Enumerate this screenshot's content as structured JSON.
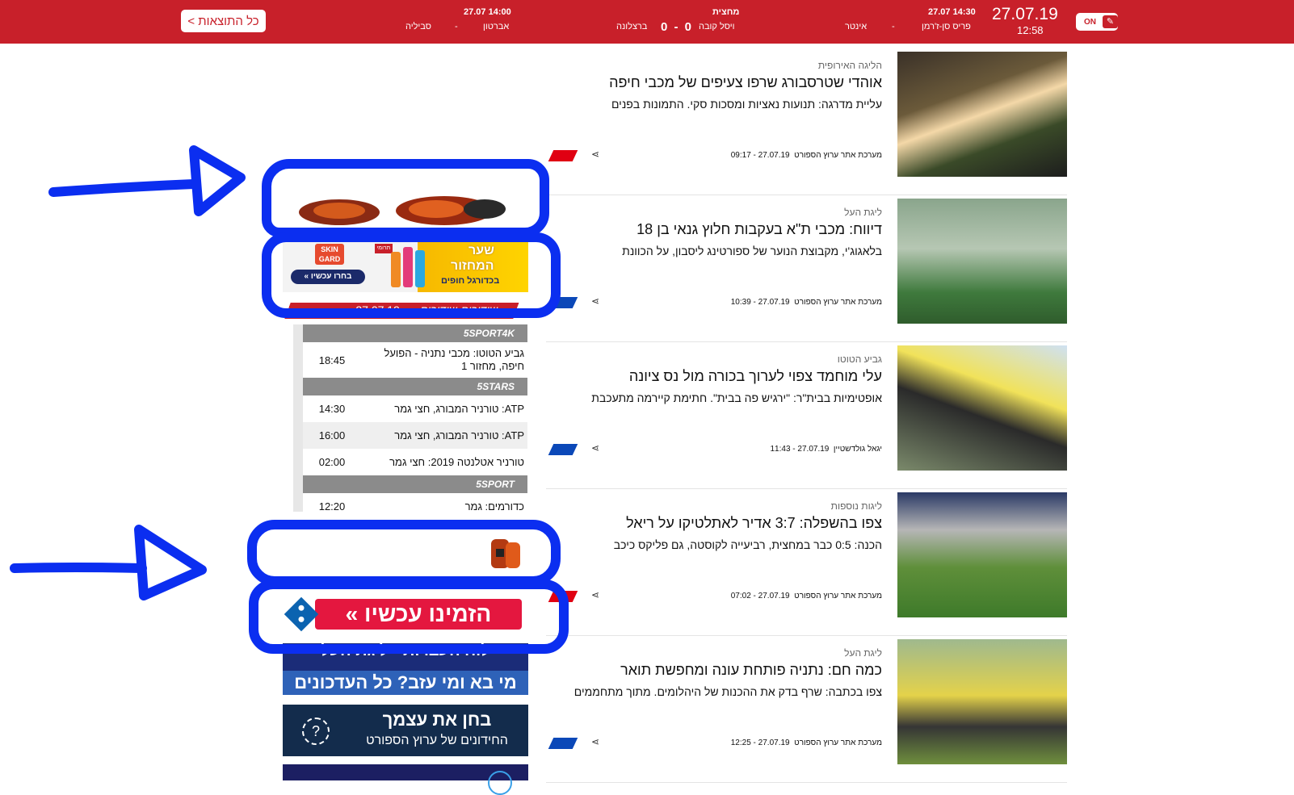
{
  "topbar": {
    "all_results": "כל התוצאות >",
    "date": "27.07.19",
    "time": "12:58",
    "live_toggle": "ON",
    "matches": [
      {
        "time": "27.07 14:30",
        "home": "פריס סן-ז'רמן",
        "score": "-",
        "away": "אינטר"
      },
      {
        "time": "מחצית",
        "home": "ויסל קובה",
        "score": "0 - 0",
        "away": "ברצלונה"
      },
      {
        "time": "27.07 14:00",
        "home": "אברטון",
        "score": "-",
        "away": "סביליה"
      }
    ]
  },
  "articles": [
    {
      "category": "הליגה האירופית",
      "title": "אוהדי שטרסבורג שרפו צעיפים של מכבי חיפה",
      "subtitle": "עליית מדרגה: תנועות נאציות ומסכות סקי. התמונות בפנים",
      "author": "מערכת אתר ערוץ הספורט",
      "datetime": "27.07.19 - 09:17",
      "flag_color": "#e00012"
    },
    {
      "category": "ליגת העל",
      "title": "דיווח: מכבי ת\"א בעקבות חלוץ גנאי בן 18",
      "subtitle": "בלאגוג'י, מקבוצת הנוער של ספורטינג ליסבון, על הכוונת",
      "author": "מערכת אתר ערוץ הספורט",
      "datetime": "27.07.19 - 10:39",
      "flag_color": "#0b48b8"
    },
    {
      "category": "גביע הטוטו",
      "title": "עלי מוחמד צפוי לערוך בכורה מול נס ציונה",
      "subtitle": "אופטימיות בבית\"ר: \"ירגיש פה בבית\". חתימת קיירמה מתעכבת",
      "author": "יגאל גולדשטיין",
      "datetime": "27.07.19 - 11:43",
      "flag_color": "#0b48b8"
    },
    {
      "category": "ליגות נוספות",
      "title": "צפו בהשפלה: 3:7 אדיר לאתלטיקו על ריאל",
      "subtitle": "הכנה: 0:5 כבר במחצית, רביעייה לקוסטה, גם פליקס כיכב",
      "author": "מערכת אתר ערוץ הספורט",
      "datetime": "27.07.19 - 07:02",
      "flag_color": "#e00012"
    },
    {
      "category": "ליגת העל",
      "title": "כמה חם: נתניה פותחת עונה ומחפשת תואר",
      "subtitle": "צפו בכתבה: שרף בדק את ההכנות של היהלומים. מתוך מתחממים",
      "author": "מערכת אתר ערוץ הספורט",
      "datetime": "27.07.19 - 12:25",
      "flag_color": "#0b48b8"
    }
  ],
  "ad_banner": {
    "brand": "SKIN GARD",
    "headline_line1": "שער",
    "headline_line2": "המחזור",
    "tagline": "בכדורגל חופים",
    "cta": "בחרו עכשיו »",
    "badge": "תרומי"
  },
  "schedule": {
    "header_title": "שידורים-שידורים",
    "header_date": "27.07.19",
    "channels": [
      {
        "name": "5SPORT4K",
        "programs": [
          {
            "time": "18:45",
            "name": "גביע הטוטו: מכבי נתניה - הפועל חיפה, מחזור 1"
          }
        ]
      },
      {
        "name": "5STARS",
        "programs": [
          {
            "time": "14:30",
            "name": "ATP: טורניר המבורג, חצי גמר"
          },
          {
            "time": "16:00",
            "name": "ATP: טורניר המבורג, חצי גמר"
          },
          {
            "time": "02:00",
            "name": "טורניר אטלנטה 2019: חצי גמר"
          }
        ]
      },
      {
        "name": "5SPORT",
        "programs": [
          {
            "time": "12:20",
            "name": "כדורמים: גמר"
          }
        ]
      }
    ]
  },
  "promos": {
    "order_now": "הזמינו עכשיו »",
    "transfers_top": "לוח העברות - ליגת העל",
    "transfers_bottom": "מי בא ומי עזב? כל העדכונים",
    "quiz_title": "בחן את עצמך",
    "quiz_sub": "החידונים של ערוץ הספורט",
    "quiz_mark": "?"
  },
  "colors": {
    "brand_red": "#c8202a",
    "annotation_blue": "#0b2ef0",
    "channel_gray": "#8b8b8b"
  }
}
